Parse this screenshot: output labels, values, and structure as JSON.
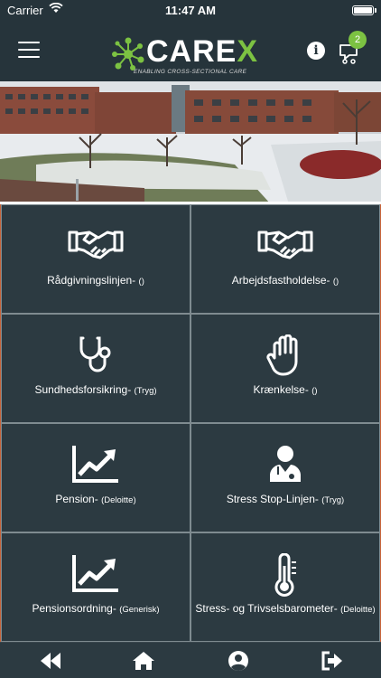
{
  "status_bar": {
    "carrier": "Carrier",
    "time": "11:47 AM"
  },
  "header": {
    "logo_text": "CARE",
    "logo_accent": "X",
    "tagline": "ENABLING CROSS-SECTIONAL CARE",
    "info_label": "i",
    "cart_count": "2"
  },
  "colors": {
    "background": "#26343b",
    "tile": "#2c3a41",
    "accent_green": "#7cc242",
    "edge_orange": "#c8643a"
  },
  "tiles": [
    {
      "title": "Rådgivningslinjen-",
      "sub": "()",
      "icon": "handshake-icon"
    },
    {
      "title": "Arbejdsfastholdelse-",
      "sub": "()",
      "icon": "handshake-icon"
    },
    {
      "title": "Sundhedsforsikring-",
      "sub": "(Tryg)",
      "icon": "stethoscope-icon"
    },
    {
      "title": "Krænkelse-",
      "sub": "()",
      "icon": "hand-icon"
    },
    {
      "title": "Pension-",
      "sub": "(Deloitte)",
      "icon": "chart-line-icon"
    },
    {
      "title": "Stress Stop-Linjen-",
      "sub": "(Tryg)",
      "icon": "doctor-icon"
    },
    {
      "title": "Pensionsordning-",
      "sub": "(Generisk)",
      "icon": "chart-line-icon"
    },
    {
      "title": "Stress- og Trivselsbarometer-",
      "sub": "(Deloitte)",
      "icon": "thermometer-icon"
    }
  ],
  "tabbar": {
    "items": [
      "back-icon",
      "home-icon",
      "profile-icon",
      "logout-icon"
    ]
  }
}
